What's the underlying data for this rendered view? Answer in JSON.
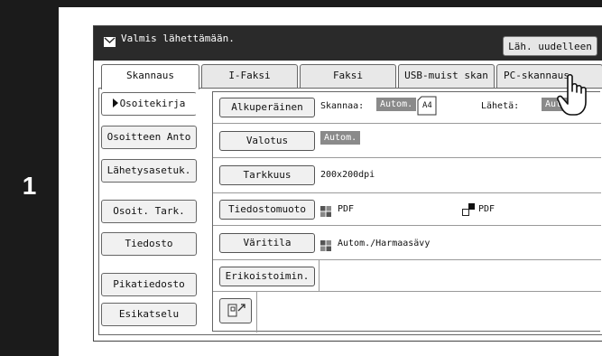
{
  "step": {
    "number": "1"
  },
  "status": {
    "message": "Valmis lähettämään.",
    "resend_button": "Läh. uudelleen"
  },
  "tabs": [
    {
      "label": "Skannaus",
      "active": true
    },
    {
      "label": "I-Faksi",
      "active": false
    },
    {
      "label": "Faksi",
      "active": false
    },
    {
      "label": "USB-muist skan",
      "active": false
    },
    {
      "label": "PC-skannaus",
      "active": false
    }
  ],
  "sidebar": [
    {
      "label": "Osoitekirja",
      "active": true
    },
    {
      "label": "Osoitteen Anto"
    },
    {
      "label": "Lähetysasetuk."
    },
    {
      "label": "Osoit. Tark."
    },
    {
      "label": "Tiedosto"
    },
    {
      "label": "Pikatiedosto"
    },
    {
      "label": "Esikatselu"
    }
  ],
  "settings": {
    "original": {
      "button": "Alkuperäinen",
      "scan_label": "Skannaa:",
      "scan_value": "Autom.",
      "paper_size": "A4",
      "send_label": "Lähetä:",
      "send_value": "Autom."
    },
    "exposure": {
      "button": "Valotus",
      "value": "Autom."
    },
    "resolution": {
      "button": "Tarkkuus",
      "value": "200x200dpi"
    },
    "file_format": {
      "button": "Tiedostomuoto",
      "value_color": "PDF",
      "value_mono": "PDF"
    },
    "color_mode": {
      "button": "Väritila",
      "value": "Autom./Harmaasävy"
    },
    "special_modes": {
      "button": "Erikoistoimin."
    }
  },
  "colors": {
    "step_bar": "#1b1b1b",
    "status_bar": "#2a2a2a",
    "highlight_value": "#8a8a8a"
  }
}
